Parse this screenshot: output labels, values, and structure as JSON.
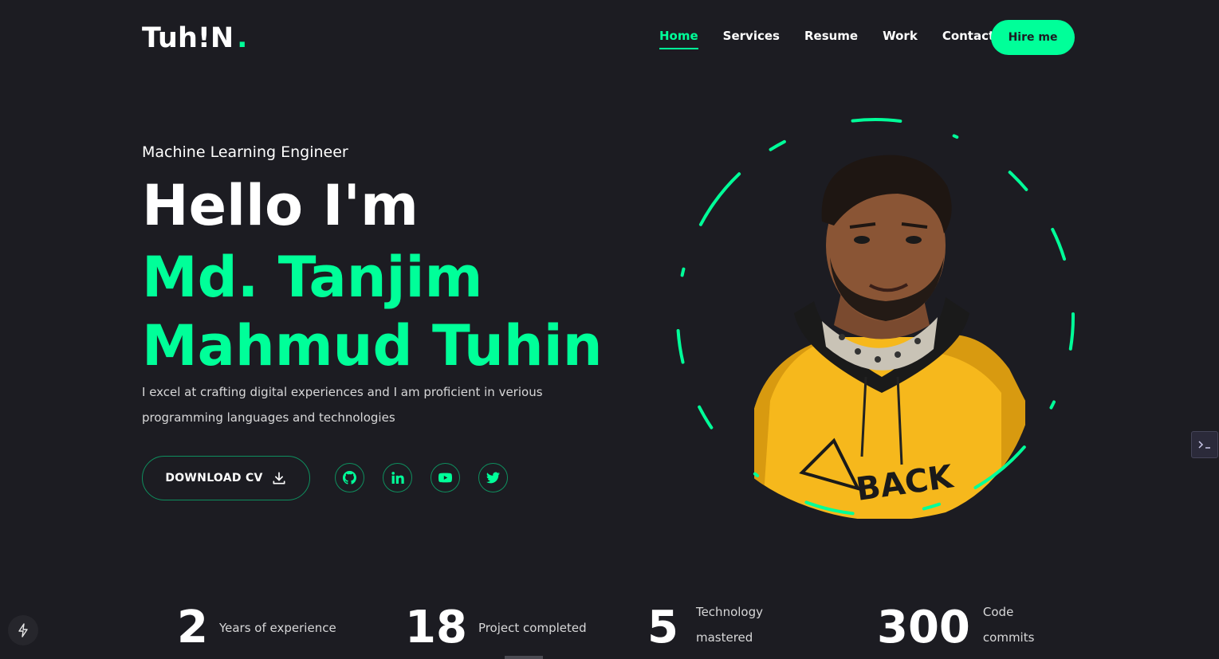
{
  "header": {
    "logo_text": "Tuh!N",
    "logo_dot": ".",
    "nav": [
      {
        "label": "Home",
        "active": true
      },
      {
        "label": "Services",
        "active": false
      },
      {
        "label": "Resume",
        "active": false
      },
      {
        "label": "Work",
        "active": false
      },
      {
        "label": "Contact",
        "active": false
      }
    ],
    "hire_label": "Hire me"
  },
  "hero": {
    "role": "Machine Learning Engineer",
    "greeting": "Hello I'm",
    "name_line1": "Md. Tanjim",
    "name_line2": "Mahmud Tuhin",
    "description": "I excel at crafting digital experiences and I am proficient in verious programming languages and technologies",
    "download_label": "DOWNLOAD CV",
    "socials": [
      "github-icon",
      "linkedin-icon",
      "youtube-icon",
      "twitter-icon"
    ]
  },
  "stats": [
    {
      "num": "2",
      "label_line1": "Years of experience",
      "label_line2": ""
    },
    {
      "num": "18",
      "label_line1": "Project completed",
      "label_line2": ""
    },
    {
      "num": "5",
      "label_line1": "Technology",
      "label_line2": "mastered"
    },
    {
      "num": "300",
      "label_line1": "Code",
      "label_line2": "commits"
    }
  ],
  "colors": {
    "accent": "#00ff99",
    "background": "#1c1c22",
    "text": "#ffffff"
  }
}
